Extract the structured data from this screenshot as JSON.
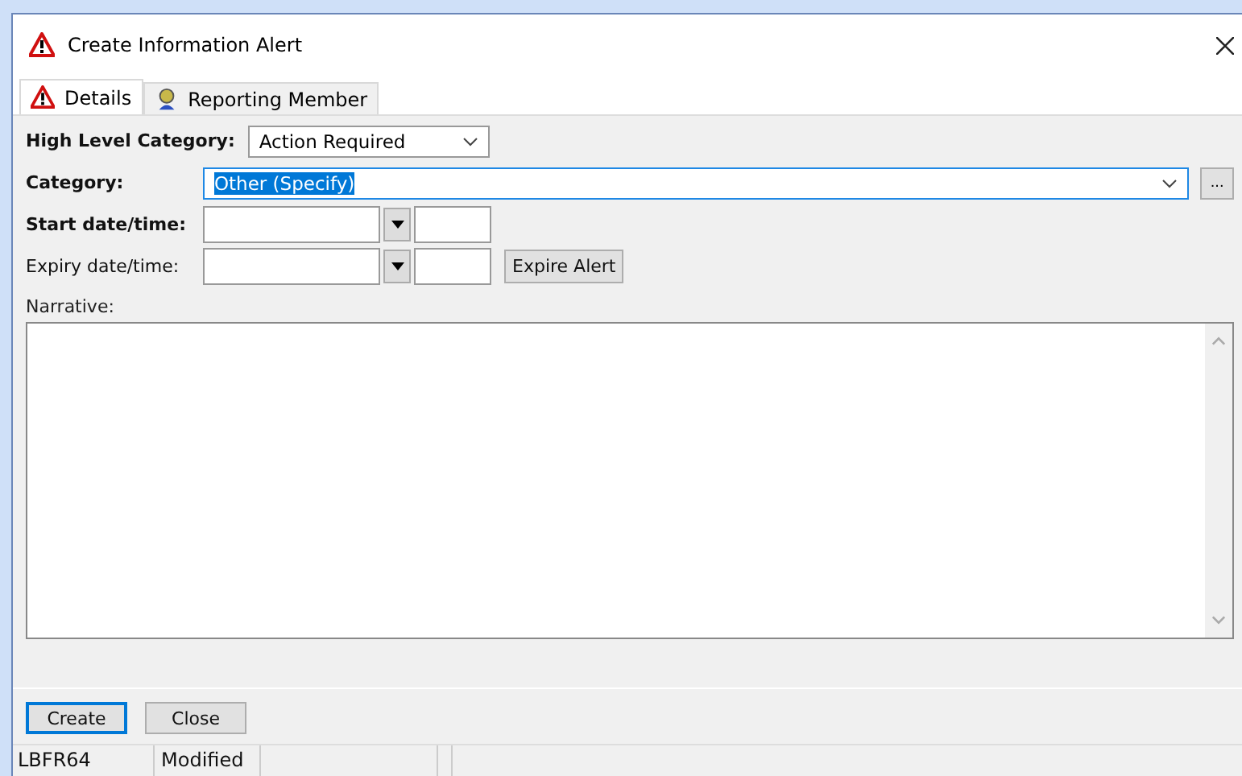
{
  "window": {
    "title": "Create Information Alert"
  },
  "tabs": [
    {
      "label": "Details",
      "selected": true
    },
    {
      "label": "Reporting Member",
      "selected": false
    }
  ],
  "fields": [
    {
      "kind": "dropdown",
      "label": "High Level Category:",
      "required": true,
      "value": "Action Required",
      "focused": false
    },
    {
      "kind": "dropdown",
      "label": "Category:",
      "required": true,
      "value": "Other (Specify)",
      "focused": true,
      "browse": "..."
    },
    {
      "kind": "datetime",
      "label": "Start date/time:",
      "required": true
    },
    {
      "kind": "datetime",
      "label": "Expiry date/time:",
      "required": false,
      "action": "Expire Alert"
    }
  ],
  "narrative": {
    "label": "Narrative:"
  },
  "buttons": [
    {
      "label": "Create",
      "default": true
    },
    {
      "label": "Close",
      "default": false
    }
  ],
  "status_bar": [
    "LBFR64",
    "Modified"
  ]
}
